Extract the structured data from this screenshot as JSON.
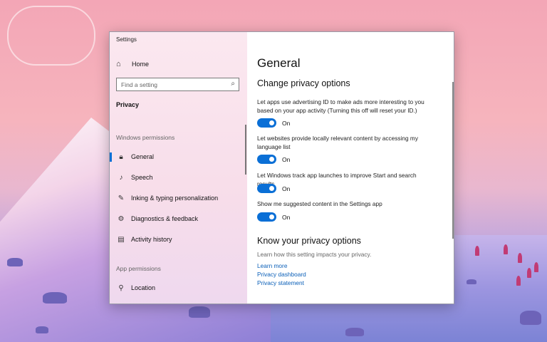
{
  "window": {
    "title": "Settings",
    "controls": {
      "minimize": "─",
      "maximize": "☐",
      "close": "✕"
    }
  },
  "sidebar": {
    "home_label": "Home",
    "search_placeholder": "Find a setting",
    "category": "Privacy",
    "windows_permissions_header": "Windows permissions",
    "windows_items": [
      {
        "label": "General",
        "icon": "lock-icon",
        "active": true
      },
      {
        "label": "Speech",
        "icon": "speech-icon"
      },
      {
        "label": "Inking & typing personalization",
        "icon": "inking-icon"
      },
      {
        "label": "Diagnostics & feedback",
        "icon": "diagnostics-icon"
      },
      {
        "label": "Activity history",
        "icon": "activity-history-icon"
      }
    ],
    "app_permissions_header": "App permissions",
    "app_items": [
      {
        "label": "Location",
        "icon": "location-icon"
      }
    ]
  },
  "main": {
    "title": "General",
    "section1_heading": "Change privacy options",
    "options": [
      {
        "text": "Let apps use advertising ID to make ads more interesting to you based on your app activity (Turning this off will reset your ID.)",
        "state": "On"
      },
      {
        "text": "Let websites provide locally relevant content by accessing my language list",
        "state": "On"
      },
      {
        "text": "Let Windows track app launches to improve Start and search results",
        "state": "On"
      },
      {
        "text": "Show me suggested content in the Settings app",
        "state": "On"
      }
    ],
    "section2_heading": "Know your privacy options",
    "section2_desc": "Learn how this setting impacts your privacy.",
    "links": [
      "Learn more",
      "Privacy dashboard",
      "Privacy statement"
    ]
  },
  "colors": {
    "accent": "#0a6fd6",
    "link": "#0a5fb8"
  }
}
